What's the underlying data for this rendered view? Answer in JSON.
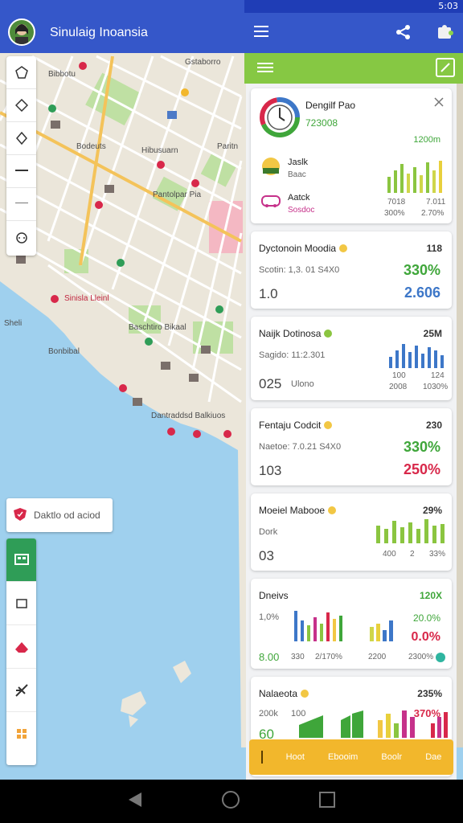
{
  "status": {
    "time": "5:03"
  },
  "app": {
    "title": "Sinulaig Inoansia"
  },
  "map": {
    "labels": [
      "Gstaborro",
      "Bodeuts",
      "Hibusuarn",
      "Pantolpar Pia",
      "Paritn",
      "Bibbotu",
      "Sinisla Lleinl",
      "Baschtiro Bikaal",
      "Sheli",
      "Bonbibal",
      "Dantraddsd Balkiuos"
    ],
    "legend_label": "Daktlo od aciod"
  },
  "panel": {
    "summary": {
      "title": "Dengilf Pao",
      "subtitle": "723008",
      "top_value": "1200m",
      "row1_title": "Jaslk",
      "row1_sub": "Baac",
      "row2_title": "Aatck",
      "row2_sub": "Sosdoc",
      "foot1": "7018",
      "foot2": "7.011",
      "foot3": "300%",
      "foot4": "2.70%"
    },
    "cards": [
      {
        "title": "Dyctonoin Moodia",
        "top": "118",
        "sub": "Scotin: 1,3. 01 S4X0",
        "pct": "330%",
        "big": "1.0",
        "big2": "2.606",
        "pct_color": "#3fa63a",
        "big2_color": "#3d77c8"
      },
      {
        "title": "Naijk Dotinosa",
        "top": "25M",
        "sub": "Sagido: 11:2.301",
        "big": "025",
        "big_label": "Ulono",
        "foot1": "100",
        "foot2": "124",
        "foot3": "2008",
        "foot4": "1030%",
        "pct": "",
        "big2": ""
      },
      {
        "title": "Fentaju Codcit",
        "top": "230",
        "sub": "Naetoe: 7.0.21 S4X0",
        "pct": "330%",
        "big": "103",
        "big2": "250%",
        "pct_color": "#3fa63a",
        "big2_color": "#d8284a"
      },
      {
        "title": "Moeiel Mabooe",
        "top": "29%",
        "sub": "Dork",
        "big": "03",
        "foot1": "400",
        "foot2": "2",
        "foot3": "33%"
      },
      {
        "title": "Dneivs",
        "top": "120X",
        "sub": "1,0%",
        "pct": "20.0%",
        "pct_color": "#3fa63a",
        "big": "8.00",
        "foot1": "330",
        "foot2": "2/170%",
        "foot3": "2200",
        "foot4": "2300%",
        "big2": "0.0%",
        "big2_color": "#d8284a"
      },
      {
        "title": "Nalaeota",
        "top": "235%",
        "sub": "200k",
        "sub2": "100",
        "pct": "370%",
        "pct_color": "#d8284a",
        "big": "60"
      }
    ],
    "bottom_tabs": [
      "Hoot",
      "Ebooim",
      "Boolr",
      "Dae"
    ]
  }
}
